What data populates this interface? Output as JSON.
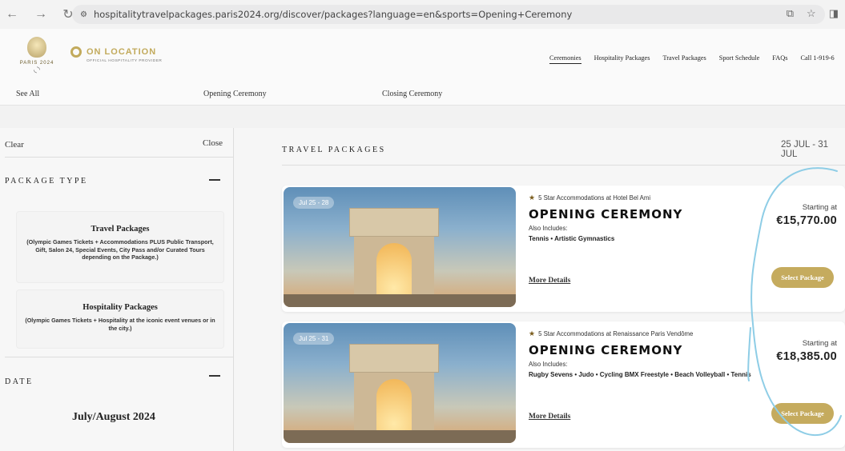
{
  "browser": {
    "url": "hospitalitytravelpackages.paris2024.org/discover/packages?language=en&sports=Opening+Ceremony"
  },
  "header": {
    "paris_logo_text": "PARIS 2024",
    "on_location_title": "ON LOCATION",
    "on_location_sub": "OFFICIAL HOSPITALITY PROVIDER",
    "nav": [
      "Ceremonies",
      "Hospitality Packages",
      "Travel Packages",
      "Sport Schedule",
      "FAQs",
      "Call 1-919-6"
    ]
  },
  "subnav": {
    "see_all": "See All",
    "opening": "Opening Ceremony",
    "closing": "Closing Ceremony"
  },
  "sidebar": {
    "clear": "Clear",
    "close": "Close",
    "package_type_heading": "PACKAGE TYPE",
    "options": [
      {
        "title": "Travel Packages",
        "desc": "(Olympic Games Tickets + Accommodations PLUS Public Transport, Gift, Salon 24, Special Events, City Pass and/or Curated Tours depending on the Package.)"
      },
      {
        "title": "Hospitality Packages",
        "desc": "(Olympic Games Tickets + Hospitality at the iconic event venues or in the city.)"
      }
    ],
    "date_heading": "DATE",
    "date_value": "July/August 2024"
  },
  "main": {
    "title": "TRAVEL PACKAGES",
    "date_range": "25 JUL - 31 JUL",
    "packages": [
      {
        "date_badge": "Jul 25 - 28",
        "accommodation": "5 Star Accommodations at Hotel Bel Ami",
        "name": "OPENING CEREMONY",
        "also_includes_label": "Also Includes:",
        "sports": "Tennis • Artistic Gymnastics",
        "more": "More Details",
        "price_label": "Starting at",
        "price": "€15,770.00",
        "select": "Select Package"
      },
      {
        "date_badge": "Jul 25 - 31",
        "accommodation": "5 Star Accommodations at Renaissance Paris Vendôme",
        "name": "OPENING CEREMONY",
        "also_includes_label": "Also Includes:",
        "sports": "Rugby Sevens • Judo • Cycling BMX Freestyle • Beach Volleyball • Tennis",
        "more": "More Details",
        "price_label": "Starting at",
        "price": "€18,385.00",
        "select": "Select Package"
      }
    ]
  },
  "colors": {
    "accent_gold": "#c5ab5e",
    "annotation_blue": "#8ecde6"
  }
}
